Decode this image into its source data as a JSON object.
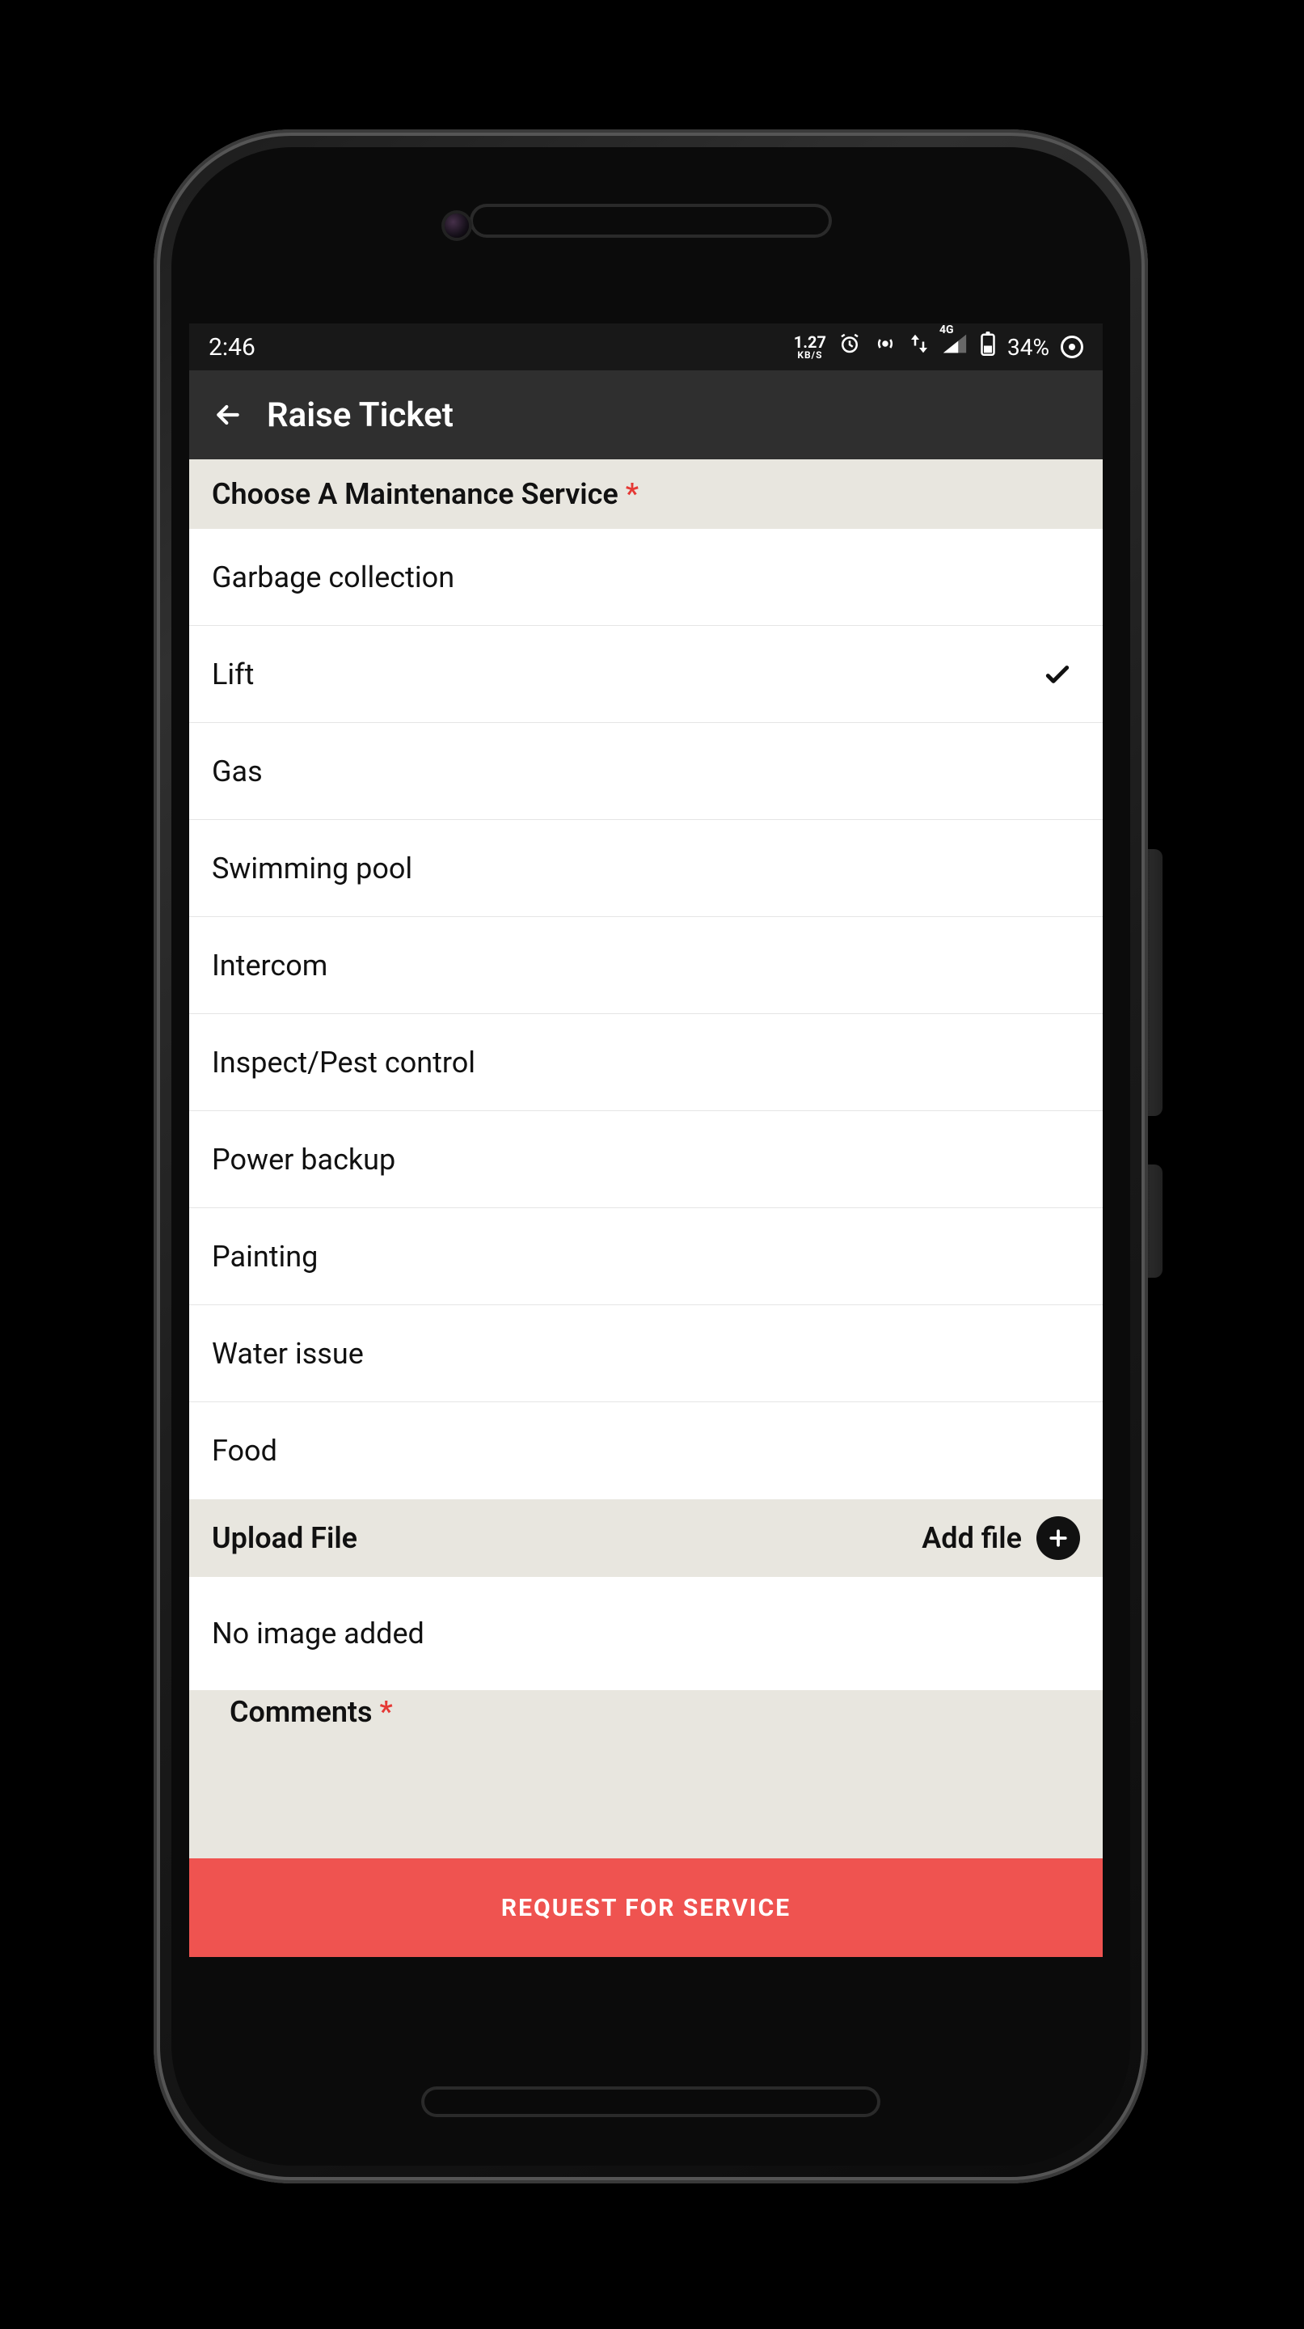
{
  "status": {
    "time": "2:46",
    "net_rate": "1.27",
    "net_unit": "KB/S",
    "net_label": "4G",
    "battery": "34%"
  },
  "appbar": {
    "title": "Raise Ticket"
  },
  "service_section": {
    "label": "Choose A Maintenance Service",
    "required": "*"
  },
  "services": [
    {
      "label": "Garbage collection",
      "selected": false
    },
    {
      "label": "Lift",
      "selected": true
    },
    {
      "label": "Gas",
      "selected": false
    },
    {
      "label": "Swimming pool",
      "selected": false
    },
    {
      "label": "Intercom",
      "selected": false
    },
    {
      "label": "Inspect/Pest control",
      "selected": false
    },
    {
      "label": "Power backup",
      "selected": false
    },
    {
      "label": "Painting",
      "selected": false
    },
    {
      "label": "Water issue",
      "selected": false
    },
    {
      "label": "Food",
      "selected": false
    }
  ],
  "upload": {
    "label": "Upload File",
    "action": "Add file",
    "empty": "No image added"
  },
  "comments": {
    "label": "Comments",
    "required": "*"
  },
  "submit": {
    "label": "REQUEST FOR SERVICE"
  },
  "colors": {
    "accent": "#ef5350",
    "required": "#e53935",
    "section_bg": "#e8e6df",
    "appbar_bg": "#2f2f2f"
  }
}
